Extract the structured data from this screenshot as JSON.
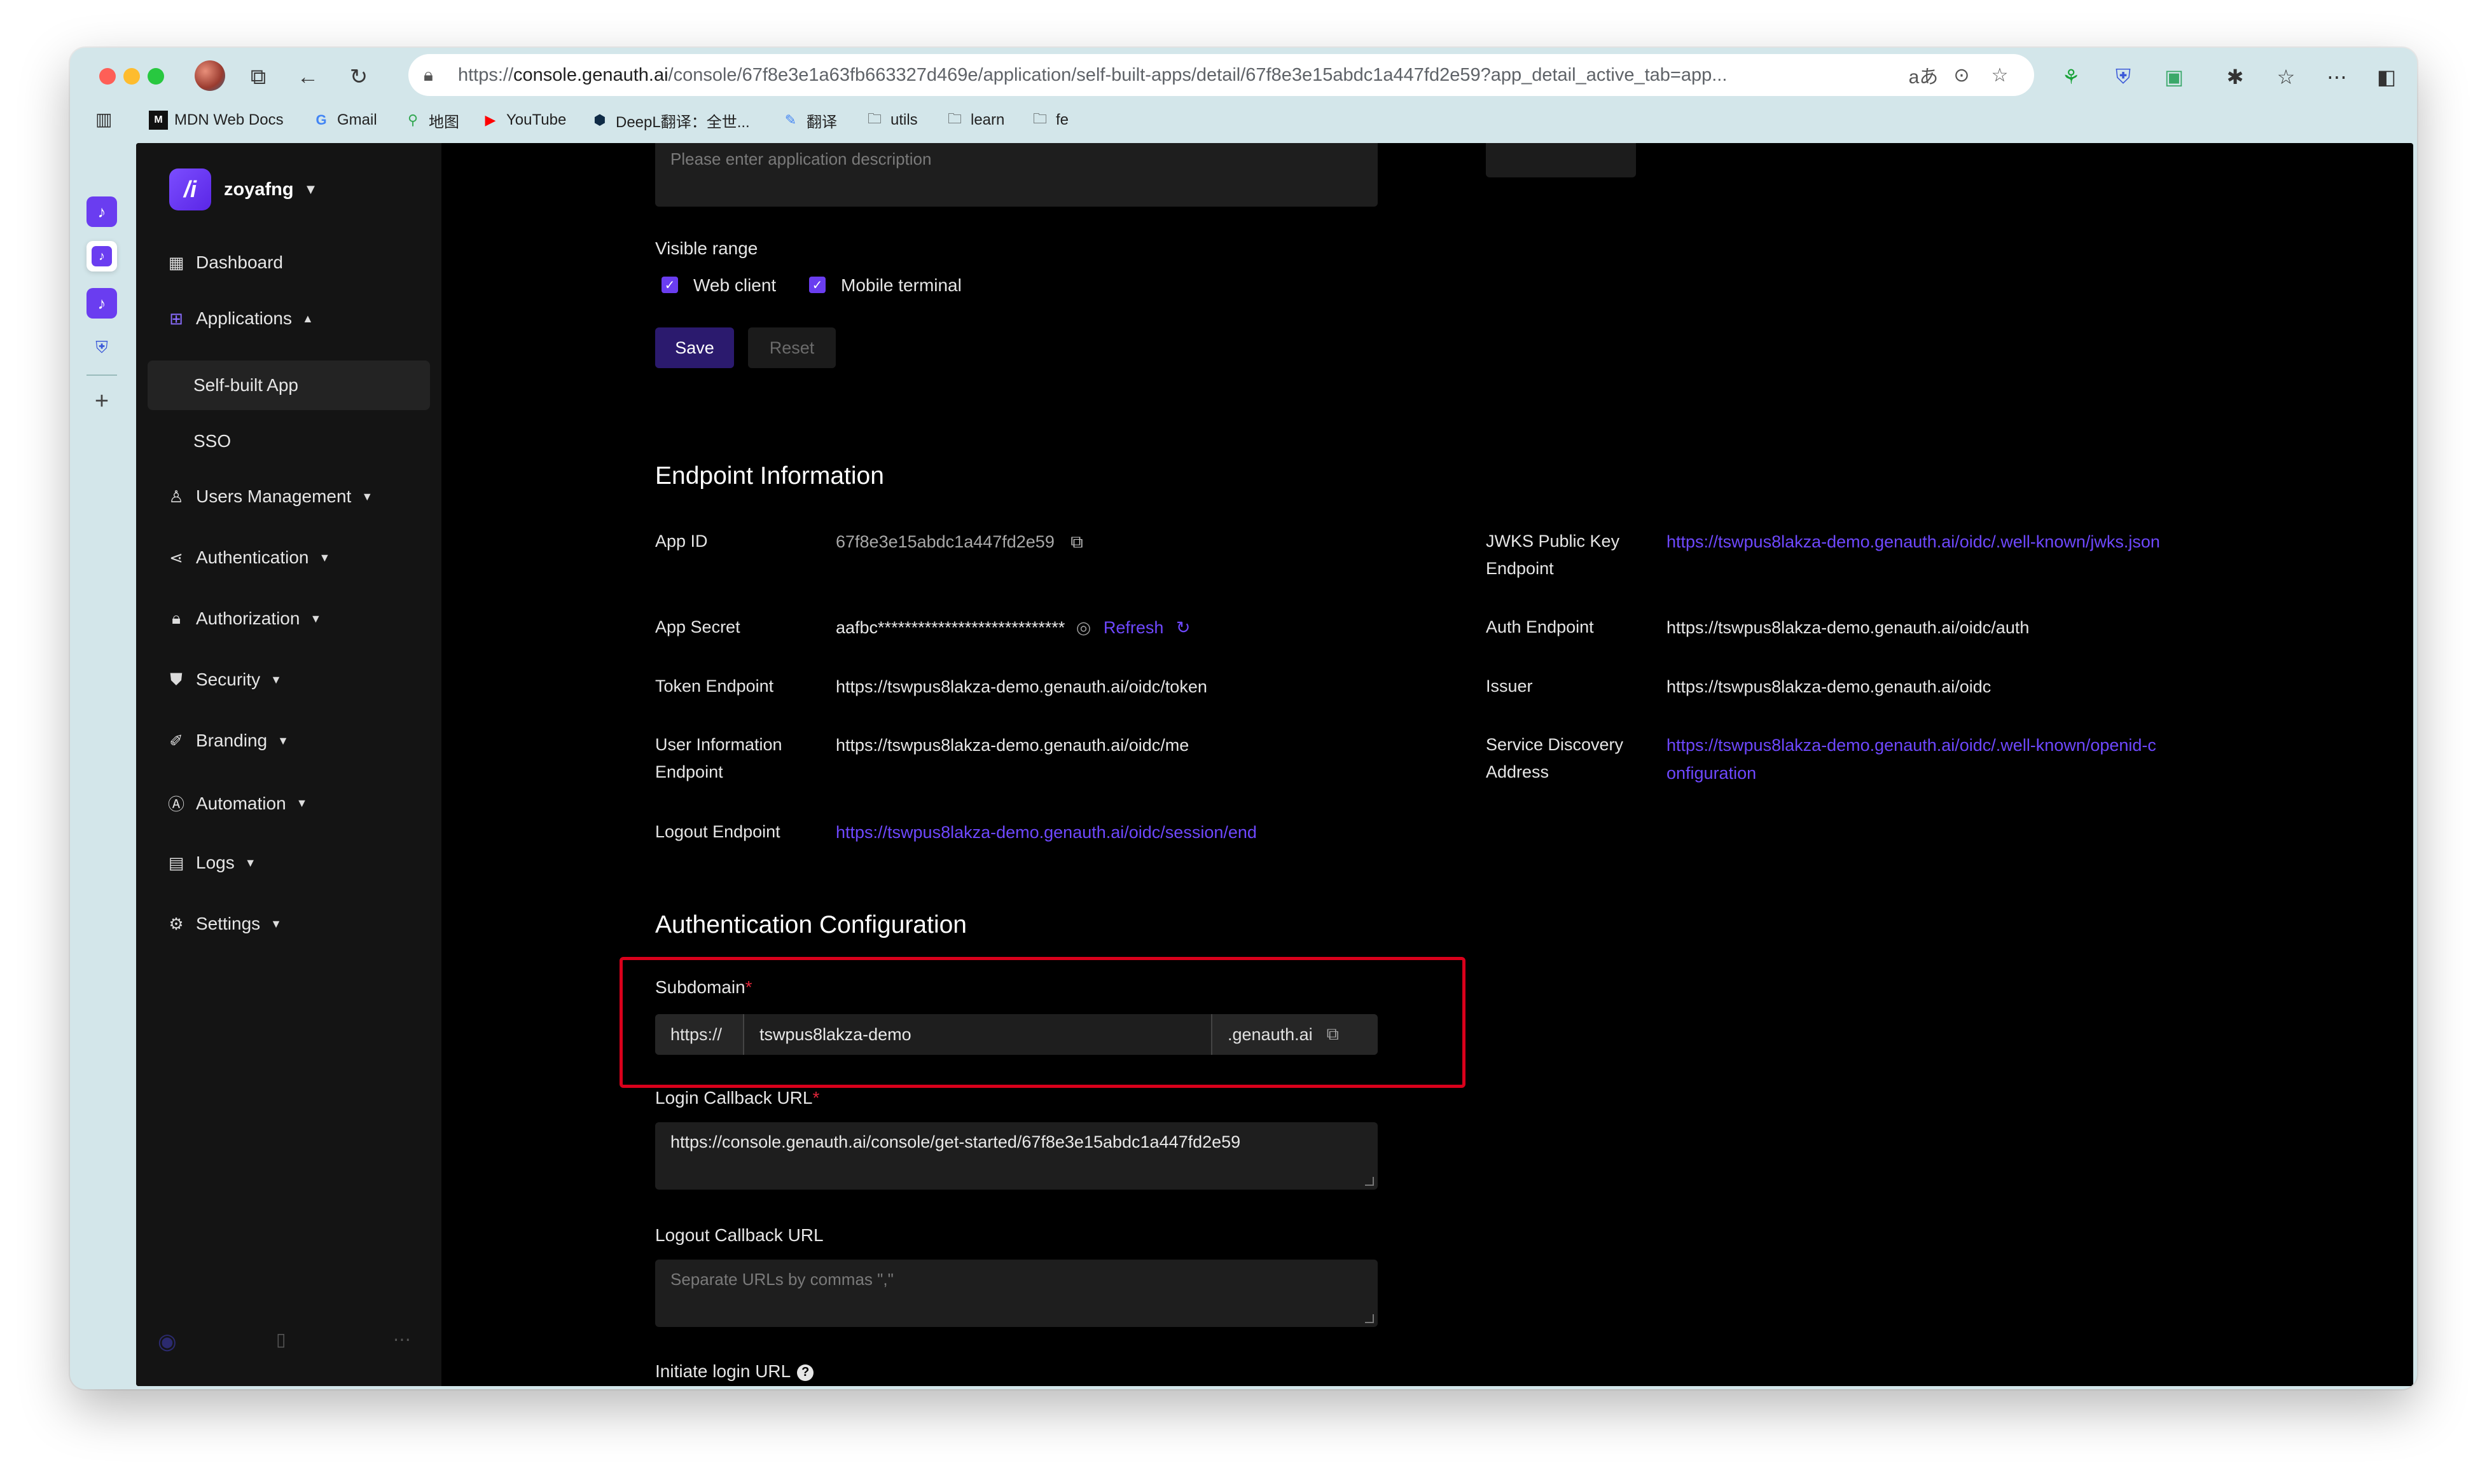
{
  "browser": {
    "url_prefix": "https://",
    "url_domain": "console.genauth.ai",
    "url_path": "/console/67f8e3e1a63fb663327d469e/application/self-built-apps/detail/67f8e3e15abdc1a447fd2e59?app_detail_active_tab=app...",
    "translate_glyph": "aあ",
    "bookmarks": [
      {
        "label": "MDN Web Docs",
        "icon": "mdn-icon"
      },
      {
        "label": "Gmail",
        "icon": "google-icon"
      },
      {
        "label": "地图",
        "icon": "maps-icon"
      },
      {
        "label": "YouTube",
        "icon": "youtube-icon"
      },
      {
        "label": "DeepL翻译：全世...",
        "icon": "deepl-icon"
      },
      {
        "label": "翻译",
        "icon": "translate-icon"
      },
      {
        "label": "utils",
        "icon": "folder-icon"
      },
      {
        "label": "learn",
        "icon": "folder-icon"
      },
      {
        "label": "fe",
        "icon": "folder-icon"
      }
    ]
  },
  "sidebar": {
    "org_name": "zoyafng",
    "items": [
      {
        "label": "Dashboard"
      },
      {
        "label": "Applications"
      },
      {
        "label": "Self-built App"
      },
      {
        "label": "SSO"
      },
      {
        "label": "Users Management"
      },
      {
        "label": "Authentication"
      },
      {
        "label": "Authorization"
      },
      {
        "label": "Security"
      },
      {
        "label": "Branding"
      },
      {
        "label": "Automation"
      },
      {
        "label": "Logs"
      },
      {
        "label": "Settings"
      }
    ]
  },
  "form": {
    "description_placeholder": "Please enter application description",
    "visible_range_label": "Visible range",
    "web_client_label": "Web client",
    "mobile_terminal_label": "Mobile terminal",
    "save_label": "Save",
    "reset_label": "Reset"
  },
  "endpoint": {
    "heading": "Endpoint Information",
    "app_id_label": "App ID",
    "app_id": "67f8e3e15abdc1a447fd2e59",
    "app_secret_label": "App Secret",
    "app_secret": "aafbc****************************",
    "refresh_label": "Refresh",
    "token_label": "Token Endpoint",
    "token": "https://tswpus8lakza-demo.genauth.ai/oidc/token",
    "userinfo_label": "User Information Endpoint",
    "userinfo": "https://tswpus8lakza-demo.genauth.ai/oidc/me",
    "logout_label": "Logout Endpoint",
    "logout": "https://tswpus8lakza-demo.genauth.ai/oidc/session/end",
    "jwks_label": "JWKS Public Key Endpoint",
    "jwks": "https://tswpus8lakza-demo.genauth.ai/oidc/.well-known/jwks.json",
    "auth_label": "Auth Endpoint",
    "auth": "https://tswpus8lakza-demo.genauth.ai/oidc/auth",
    "issuer_label": "Issuer",
    "issuer": "https://tswpus8lakza-demo.genauth.ai/oidc",
    "discovery_label": "Service Discovery Address",
    "discovery_line1": "https://tswpus8lakza-demo.genauth.ai/oidc/.well-known/openid-c",
    "discovery_line2": "onfiguration"
  },
  "auth_config": {
    "heading": "Authentication Configuration",
    "subdomain_label": "Subdomain",
    "required_mark": "*",
    "subdomain_prefix": "https://",
    "subdomain_value": "tswpus8lakza-demo",
    "subdomain_suffix": ".genauth.ai",
    "login_callback_label": "Login Callback URL",
    "login_callback_value": "https://console.genauth.ai/console/get-started/67f8e3e15abdc1a447fd2e59",
    "logout_callback_label": "Logout Callback URL",
    "logout_callback_placeholder": "Separate URLs by commas \",\"",
    "initiate_login_label": "Initiate login URL"
  },
  "colors": {
    "accent": "#6a3df0",
    "link": "#6e48ff",
    "highlight_box": "#d9001b"
  }
}
